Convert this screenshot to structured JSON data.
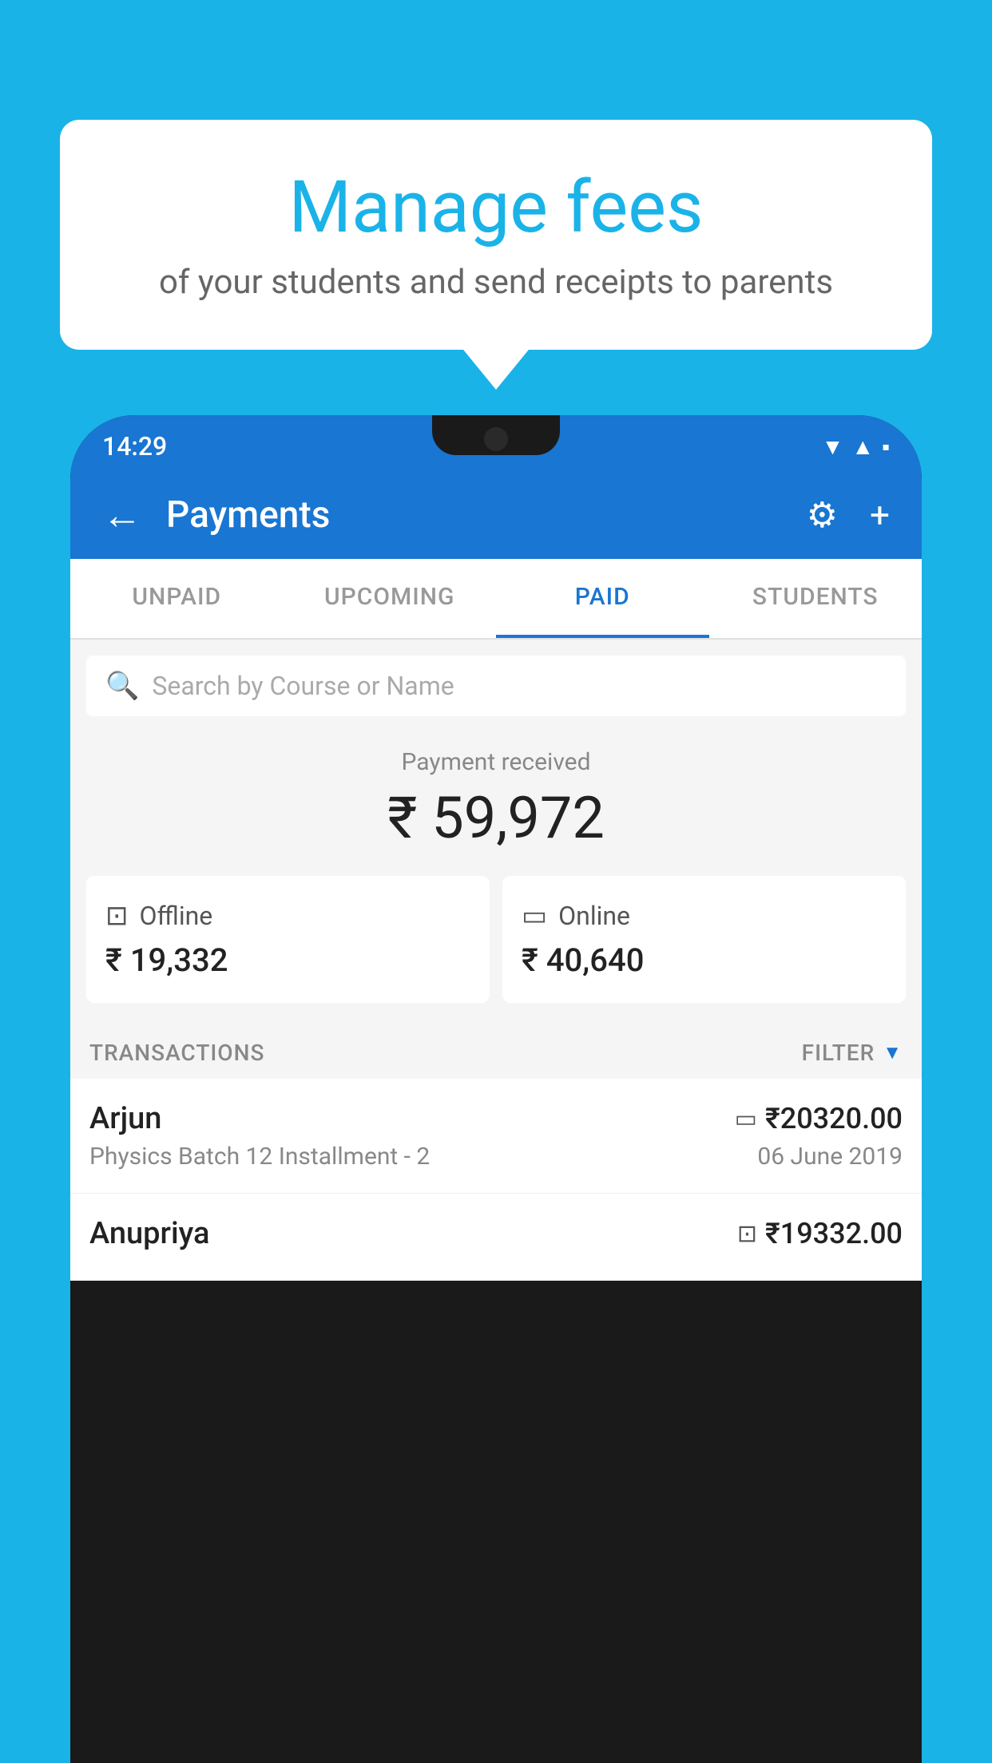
{
  "background_color": "#1ab3e8",
  "speech_bubble": {
    "title": "Manage fees",
    "subtitle": "of your students and send receipts to parents"
  },
  "status_bar": {
    "time": "14:29",
    "icons": [
      "wifi",
      "signal",
      "battery"
    ]
  },
  "app_bar": {
    "title": "Payments",
    "back_label": "←",
    "gear_label": "⚙",
    "plus_label": "+"
  },
  "tabs": [
    {
      "label": "UNPAID",
      "active": false
    },
    {
      "label": "UPCOMING",
      "active": false
    },
    {
      "label": "PAID",
      "active": true
    },
    {
      "label": "STUDENTS",
      "active": false
    }
  ],
  "search": {
    "placeholder": "Search by Course or Name"
  },
  "payment_received": {
    "label": "Payment received",
    "amount": "₹ 59,972"
  },
  "cards": [
    {
      "icon": "💳",
      "type": "Offline",
      "amount": "₹ 19,332"
    },
    {
      "icon": "💳",
      "type": "Online",
      "amount": "₹ 40,640"
    }
  ],
  "transactions_header": {
    "label": "TRANSACTIONS",
    "filter_label": "FILTER"
  },
  "transactions": [
    {
      "name": "Arjun",
      "amount": "₹20320.00",
      "amount_icon": "💳",
      "course": "Physics Batch 12 Installment - 2",
      "date": "06 June 2019"
    },
    {
      "name": "Anupriya",
      "amount": "₹19332.00",
      "amount_icon": "💵",
      "course": "",
      "date": ""
    }
  ]
}
